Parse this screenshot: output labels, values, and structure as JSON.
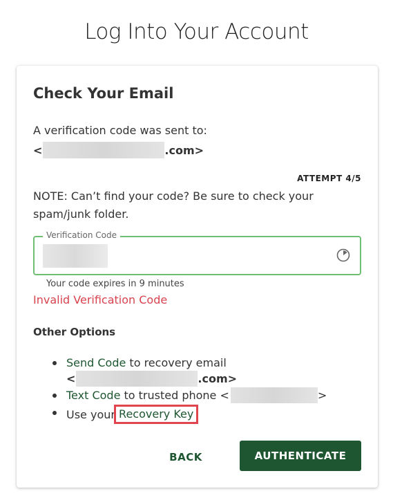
{
  "page": {
    "title": "Log Into Your Account"
  },
  "card": {
    "title": "Check Your Email",
    "sent_to_text": "A verification code was sent to:",
    "email_prefix": "<",
    "email_suffix": ".com>",
    "attempt": "ATTEMPT 4/5",
    "note": "NOTE: Can’t find your code? Be sure to check your spam/junk folder."
  },
  "field": {
    "label": "Verification Code",
    "icon": "timer-icon",
    "expires": "Your code expires in 9 minutes",
    "error": "Invalid Verification Code"
  },
  "other_options": {
    "title": "Other Options",
    "send_code": {
      "link": "Send Code",
      "text": " to recovery email",
      "email_prefix": "<",
      "email_suffix": ".com>"
    },
    "text_code": {
      "link": "Text Code",
      "text": " to trusted phone <",
      "suffix": ">"
    },
    "recovery": {
      "text": "Use your ",
      "link": "Recovery Key"
    }
  },
  "buttons": {
    "back": "BACK",
    "authenticate": "AUTHENTICATE"
  },
  "colors": {
    "brand_green": "#1e5631",
    "field_border": "#6fbf73",
    "error_red": "#d9434f",
    "highlight_red": "#e0454f"
  }
}
